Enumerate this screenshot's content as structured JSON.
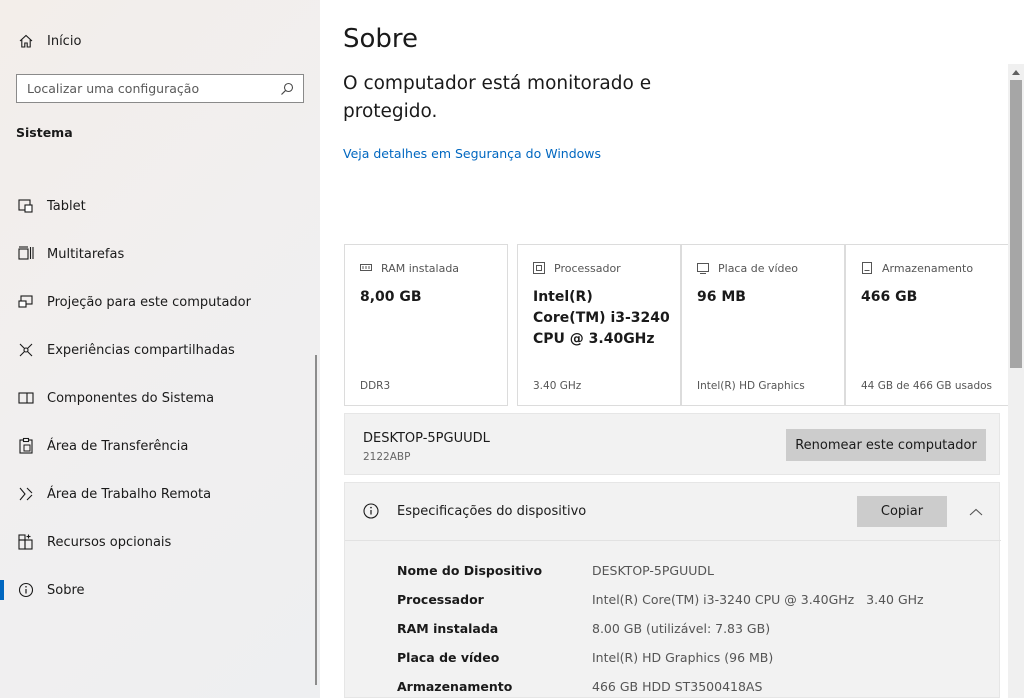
{
  "sidebar": {
    "home_label": "Início",
    "search_placeholder": "Localizar uma configuração",
    "section_title": "Sistema",
    "items": [
      {
        "label": "Tablet",
        "icon": "tablet-icon"
      },
      {
        "label": "Multitarefas",
        "icon": "multitask-icon"
      },
      {
        "label": "Projeção para este computador",
        "icon": "projection-icon"
      },
      {
        "label": "Experiências compartilhadas",
        "icon": "shared-experiences-icon"
      },
      {
        "label": "Componentes do Sistema",
        "icon": "system-components-icon"
      },
      {
        "label": "Área de Transferência",
        "icon": "clipboard-icon"
      },
      {
        "label": "Área de Trabalho Remota",
        "icon": "remote-desktop-icon"
      },
      {
        "label": "Recursos opcionais",
        "icon": "optional-features-icon"
      },
      {
        "label": "Sobre",
        "icon": "info-icon",
        "active": true
      }
    ]
  },
  "main": {
    "title": "Sobre",
    "protection_text": "O computador está monitorado e protegido.",
    "security_link": "Veja detalhes em Segurança do Windows",
    "cards": [
      {
        "title": "RAM instalada",
        "value": "8,00 GB",
        "detail": "DDR3",
        "icon": "ram-icon"
      },
      {
        "title": "Processador",
        "value": "Intel(R) Core(TM) i3-3240 CPU @ 3.40GHz",
        "detail": "3.40 GHz",
        "icon": "processor-icon"
      },
      {
        "title": "Placa de vídeo",
        "value": "96 MB",
        "detail": "Intel(R) HD Graphics",
        "icon": "gpu-icon"
      },
      {
        "title": "Armazenamento",
        "value": "466 GB",
        "detail": "44 GB de 466 GB usados",
        "icon": "storage-icon"
      }
    ],
    "computer": {
      "name": "DESKTOP-5PGUUDL",
      "subtitle": "2122ABP",
      "rename_label": "Renomear este computador"
    },
    "specs": {
      "title": "Especificações do dispositivo",
      "copy_label": "Copiar",
      "rows": [
        {
          "key": "Nome do Dispositivo",
          "value": "DESKTOP-5PGUUDL"
        },
        {
          "key": "Processador",
          "value": "Intel(R) Core(TM) i3-3240 CPU @ 3.40GHz   3.40 GHz"
        },
        {
          "key": "RAM instalada",
          "value": "8.00 GB (utilizável: 7.83 GB)"
        },
        {
          "key": "Placa de vídeo",
          "value": "Intel(R) HD Graphics (96 MB)"
        },
        {
          "key": "Armazenamento",
          "value": "466 GB HDD ST3500418AS"
        }
      ]
    }
  },
  "colors": {
    "accent": "#0067c0",
    "button_bg": "#cccccc",
    "panel_bg": "#f2f2f2"
  }
}
